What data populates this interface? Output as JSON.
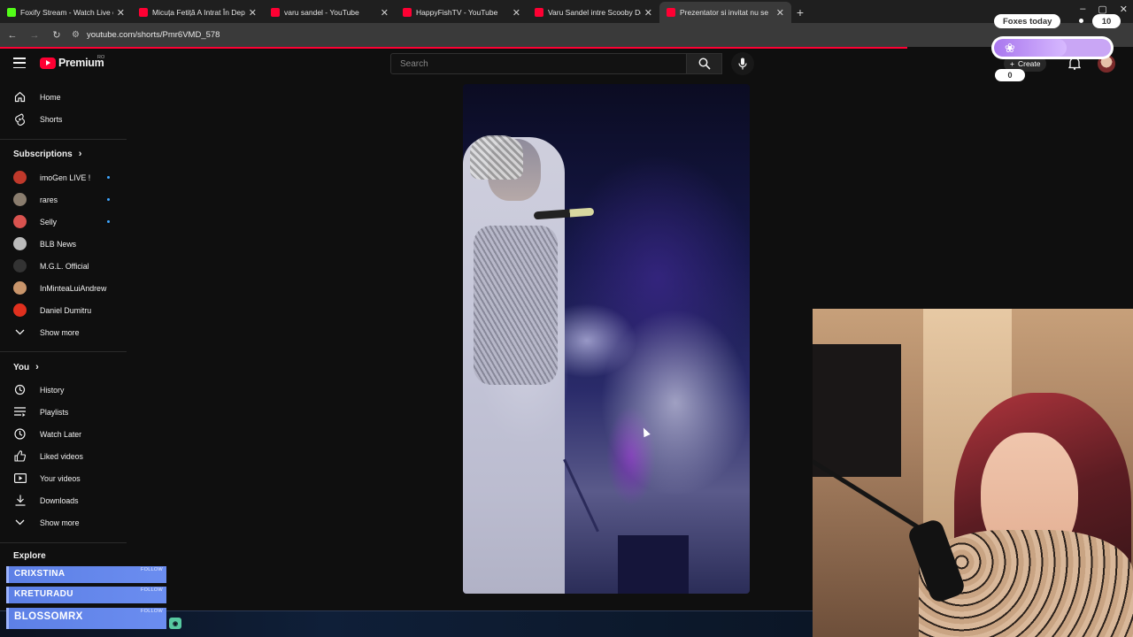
{
  "tabs": [
    {
      "title": "Foxify Stream - Watch Live on K",
      "favicon_color": "#53fc18"
    },
    {
      "title": "Micuța Fetiță A Intrat În Depre",
      "favicon_color": "#ff0033"
    },
    {
      "title": "varu sandel - YouTube",
      "favicon_color": "#ff0033"
    },
    {
      "title": "HappyFishTV - YouTube",
      "favicon_color": "#ff0033"
    },
    {
      "title": "Varu Sandel intre Scooby Doo",
      "favicon_color": "#ff0033"
    },
    {
      "title": "Prezentator si invitat nu se",
      "favicon_color": "#ff0033",
      "active": true
    }
  ],
  "address": {
    "url": "youtube.com/shorts/Pmr6VMD_578"
  },
  "header": {
    "logo_text": "Premium",
    "country": "RO",
    "search_placeholder": "Search",
    "create_label": "Create"
  },
  "sidebar": {
    "main": [
      {
        "label": "Home",
        "icon": "home-icon"
      },
      {
        "label": "Shorts",
        "icon": "shorts-icon"
      }
    ],
    "subscriptions_title": "Subscriptions",
    "subscriptions": [
      {
        "label": "imoGen LIVE !",
        "dot": true,
        "color": "#c0392b"
      },
      {
        "label": "rares",
        "dot": true,
        "color": "#8a7d6e"
      },
      {
        "label": "Selly",
        "dot": true,
        "color": "#d9534f"
      },
      {
        "label": "BLB News",
        "dot": false,
        "color": "#bbbbbb"
      },
      {
        "label": "M.G.L. Official",
        "dot": false,
        "color": "#333333"
      },
      {
        "label": "InMinteaLuiAndrew",
        "dot": false,
        "color": "#c9956b"
      },
      {
        "label": "Daniel Dumitru",
        "dot": false,
        "color": "#e0301e"
      }
    ],
    "subs_show_more": "Show more",
    "you_title": "You",
    "you": [
      {
        "label": "History",
        "icon": "history-icon"
      },
      {
        "label": "Playlists",
        "icon": "playlists-icon"
      },
      {
        "label": "Watch Later",
        "icon": "clock-icon"
      },
      {
        "label": "Liked videos",
        "icon": "thumbs-up-icon"
      },
      {
        "label": "Your videos",
        "icon": "your-videos-icon"
      },
      {
        "label": "Downloads",
        "icon": "download-icon"
      }
    ],
    "you_show_more": "Show more",
    "explore_title": "Explore"
  },
  "overlay": {
    "foxes_label": "Foxes today",
    "foxes_count": "10",
    "progress_fraction": 0.62,
    "zero_label": "0",
    "follows": [
      {
        "name": "CRIXSTINA",
        "tag": "FOLLOW"
      },
      {
        "name": "KRETURADU",
        "tag": "FOLLOW"
      },
      {
        "name": "BLOSSOMRX",
        "tag": "FOLLOW"
      }
    ]
  },
  "colors": {
    "brand": "#ff0033",
    "accent": "#3ea6ff",
    "follow_blue": "#6b8df0",
    "fox_purple": "#b58af2"
  }
}
